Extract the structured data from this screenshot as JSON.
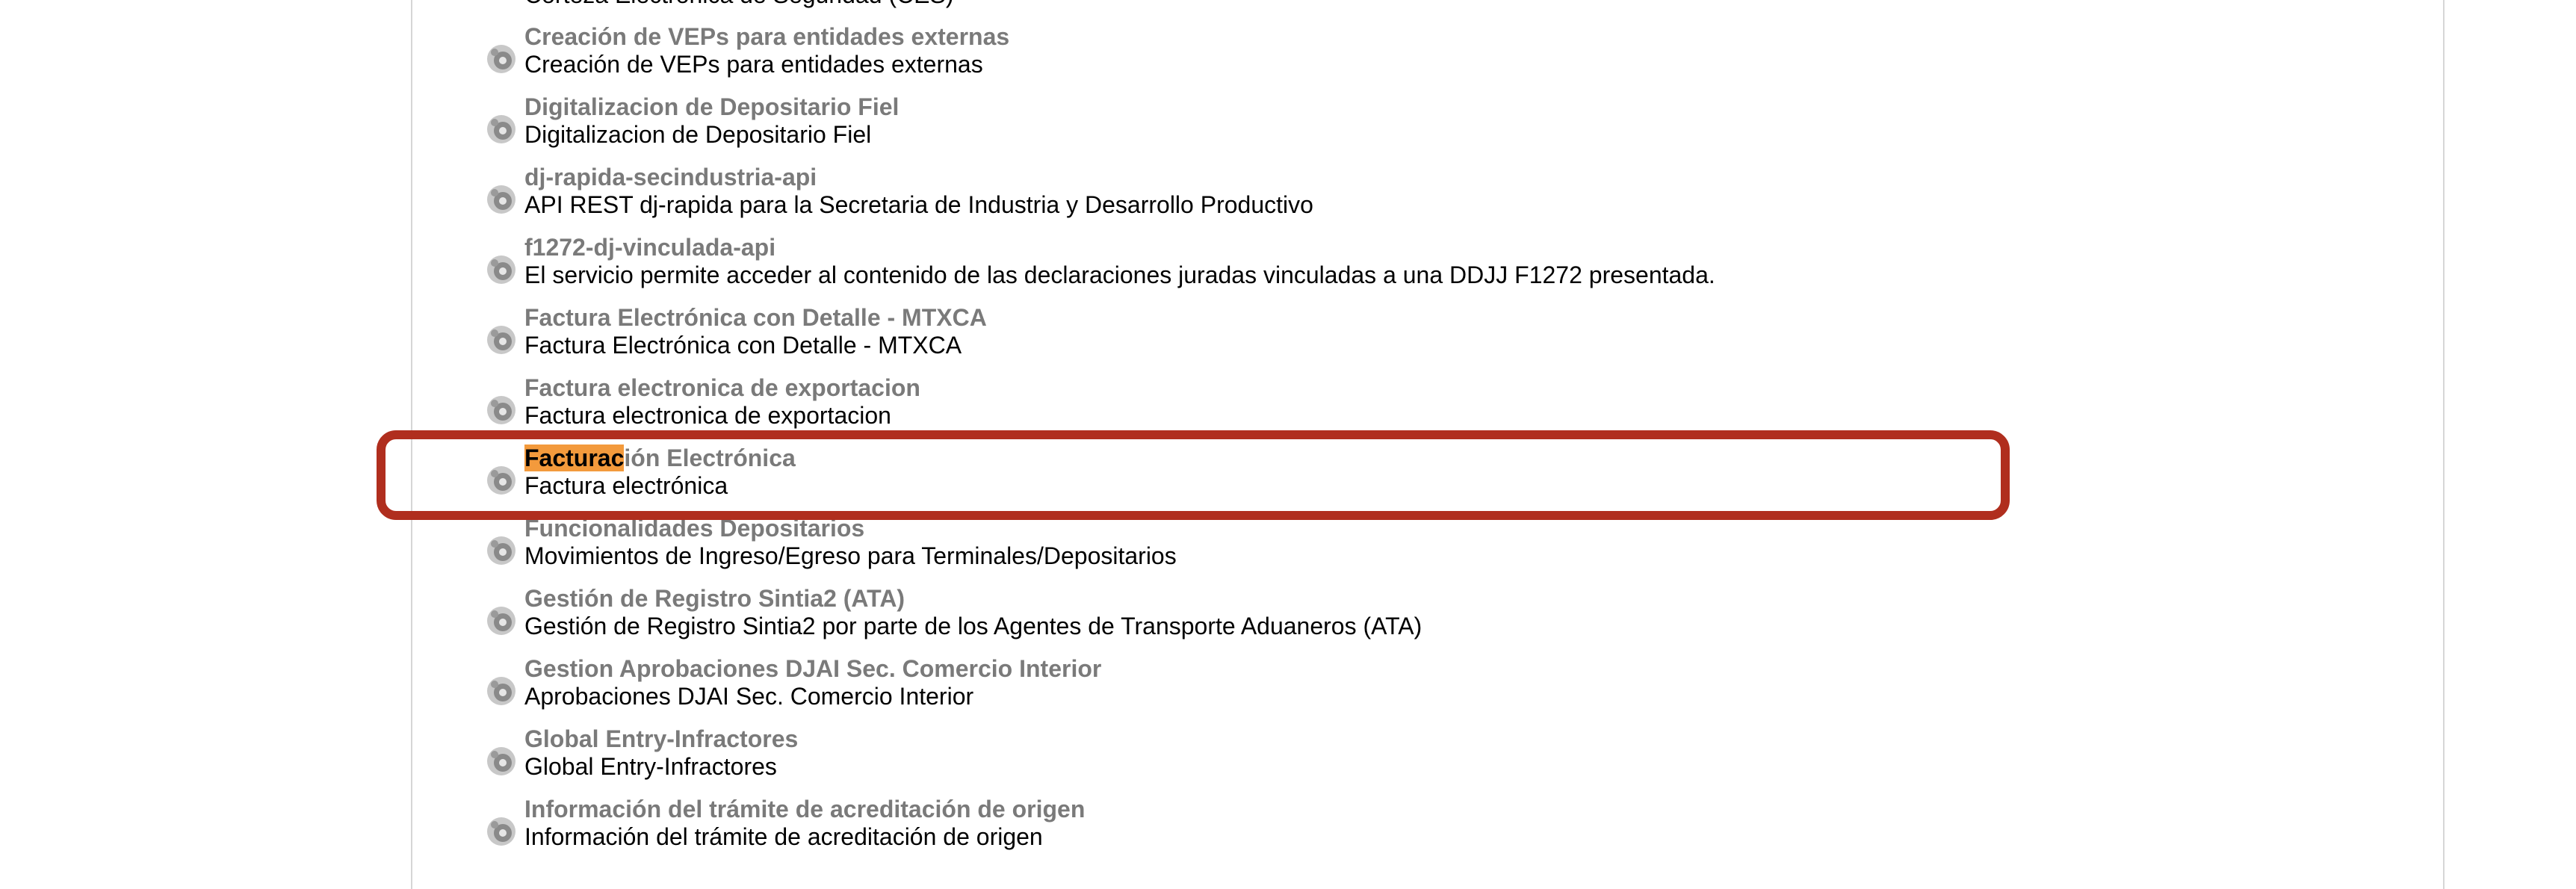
{
  "top_partial_desc": "Corteza Electrónica de Seguridad (CES)",
  "highlight_color": "#f39a3c",
  "callout_color": "#b02e1e",
  "icon": "gear-service-icon",
  "services": [
    {
      "name": "Creación de VEPs para entidades externas",
      "description": "Creación de VEPs para entidades externas"
    },
    {
      "name": "Digitalizacion de Depositario Fiel",
      "description": "Digitalizacion de Depositario Fiel"
    },
    {
      "name": "dj-rapida-secindustria-api",
      "description": "API REST dj-rapida para la Secretaria de Industria y Desarrollo Productivo"
    },
    {
      "name": "f1272-dj-vinculada-api",
      "description": "El servicio permite acceder al contenido de las declaraciones juradas vinculadas a una DDJJ F1272 presentada."
    },
    {
      "name": "Factura Electrónica con Detalle - MTXCA",
      "description": "Factura Electrónica con Detalle - MTXCA"
    },
    {
      "name": "Factura electronica de exportacion",
      "description": "Factura electronica de exportacion"
    },
    {
      "name_match": "Facturac",
      "name_rest": "ión Electrónica",
      "description": "Factura electrónica"
    },
    {
      "name": "Funcionalidades Depositarios",
      "description": "Movimientos de Ingreso/Egreso para Terminales/Depositarios"
    },
    {
      "name": "Gestión de Registro Sintia2 (ATA)",
      "description": "Gestión de Registro Sintia2 por parte de los Agentes de Transporte Aduaneros (ATA)"
    },
    {
      "name": "Gestion Aprobaciones DJAI Sec. Comercio Interior",
      "description": "Aprobaciones DJAI Sec. Comercio Interior"
    },
    {
      "name": "Global Entry-Infractores",
      "description": "Global Entry-Infractores"
    },
    {
      "name": "Información del trámite de acreditación de origen",
      "description": "Información del trámite de acreditación de origen"
    }
  ]
}
